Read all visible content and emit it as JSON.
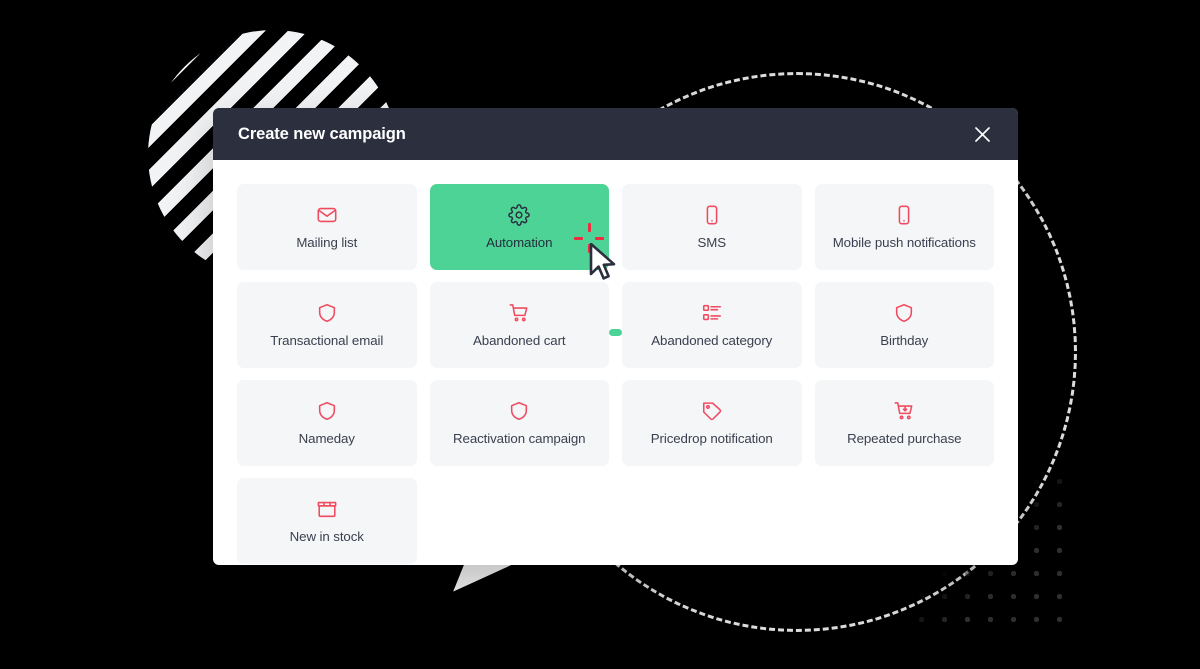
{
  "dialog": {
    "title": "Create new campaign",
    "close_icon": "close-icon",
    "header_bg": "#2b2f3e",
    "body_bg": "#ffffff"
  },
  "theme": {
    "accent_red": "#ef4c61",
    "selected_green": "#4ed397",
    "card_bg": "#f5f6f7",
    "text": "#3b4050",
    "click_burst_red": "#ef2b3f"
  },
  "cards": [
    {
      "label": "Mailing list",
      "icon": "envelope-icon",
      "selected": false
    },
    {
      "label": "Automation",
      "icon": "gear-icon",
      "selected": true
    },
    {
      "label": "SMS",
      "icon": "smartphone-icon",
      "selected": false
    },
    {
      "label": "Mobile push notifications",
      "icon": "smartphone-icon",
      "selected": false
    },
    {
      "label": "Transactional email",
      "icon": "shield-icon",
      "selected": false
    },
    {
      "label": "Abandoned cart",
      "icon": "cart-icon",
      "selected": false
    },
    {
      "label": "Abandoned category",
      "icon": "list-icon",
      "selected": false
    },
    {
      "label": "Birthday",
      "icon": "shield-icon",
      "selected": false
    },
    {
      "label": "Nameday",
      "icon": "shield-icon",
      "selected": false
    },
    {
      "label": "Reactivation campaign",
      "icon": "shield-icon",
      "selected": false
    },
    {
      "label": "Pricedrop notification",
      "icon": "price-tag-icon",
      "selected": false
    },
    {
      "label": "Repeated purchase",
      "icon": "cart-add-icon",
      "selected": false
    },
    {
      "label": "New in stock",
      "icon": "box-icon",
      "selected": false
    }
  ],
  "decorations": {
    "striped_circle": "striped-circle",
    "dashed_circle": "dashed-circle",
    "dot_grid": "dot-grid",
    "solid_triangle": "solid-triangle",
    "outline_triangle": "outline-triangle",
    "green_pill": "green-pill"
  },
  "pointer": {
    "cursor": "mouse-cursor",
    "click_burst": "click-burst"
  }
}
